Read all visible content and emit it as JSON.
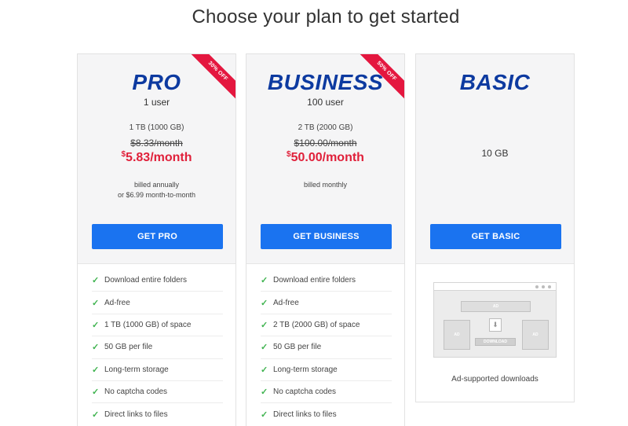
{
  "page": {
    "title": "Choose your plan to get started"
  },
  "plans": {
    "pro": {
      "ribbon": "30% OFF",
      "name": "PRO",
      "users": "1 user",
      "storage": "1 TB (1000 GB)",
      "old_price": "$8.33/month",
      "new_price_symbol": "$",
      "new_price": "5.83/month",
      "billing_line1": "billed annually",
      "billing_line2": "or $6.99 month-to-month",
      "cta": "GET PRO",
      "features": [
        "Download entire folders",
        "Ad-free",
        "1 TB (1000 GB) of space",
        "50 GB per file",
        "Long-term storage",
        "No captcha codes",
        "Direct links to files"
      ]
    },
    "business": {
      "ribbon": "50% OFF",
      "name": "BUSINESS",
      "users": "100 user",
      "storage": "2 TB (2000 GB)",
      "old_price": "$100.00/month",
      "new_price_symbol": "$",
      "new_price": "50.00/month",
      "billing_line1": "billed monthly",
      "cta": "GET BUSINESS",
      "features": [
        "Download entire folders",
        "Ad-free",
        "2 TB (2000 GB) of space",
        "50 GB per file",
        "Long-term storage",
        "No captcha codes",
        "Direct links to files"
      ]
    },
    "basic": {
      "name": "BASIC",
      "storage": "10 GB",
      "cta": "GET BASIC",
      "illustration": {
        "ad_label": "AD",
        "download_label": "DOWNLOAD"
      },
      "caption": "Ad-supported downloads"
    }
  },
  "icons": {
    "feature_check": "check-icon",
    "download": "download-icon"
  },
  "colors": {
    "brand_blue": "#0d3aa0",
    "button_blue": "#1a73f0",
    "price_red": "#e0203a",
    "check_green": "#3fb34f"
  }
}
